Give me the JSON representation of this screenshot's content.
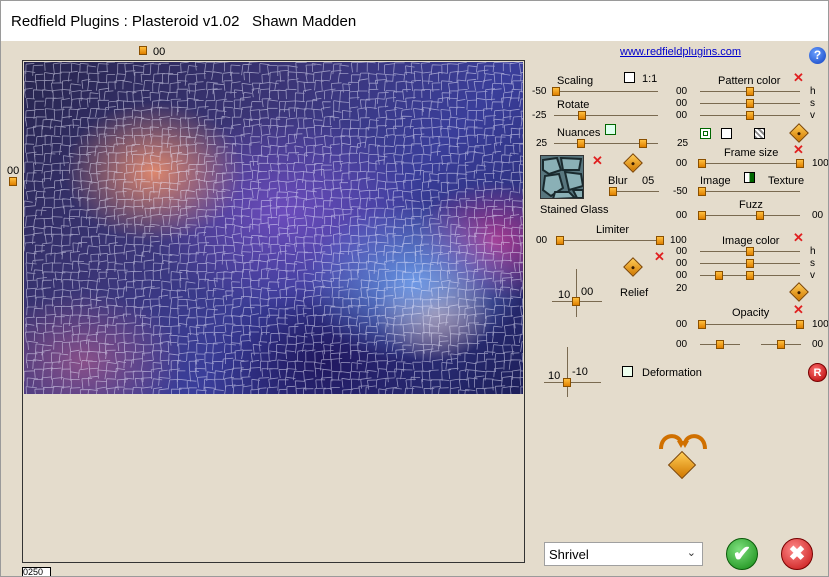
{
  "title": "Redfield Plugins : Plasteroid v1.02   Shawn Madden",
  "link_text": "www.redfieldplugins.com",
  "help_label": "?",
  "preview": {
    "top_value": "00",
    "left_value": "00",
    "coord_value": "0250"
  },
  "scaling": {
    "label": "Scaling",
    "ratio_label": "1:1",
    "value": "-50"
  },
  "rotate": {
    "label": "Rotate",
    "value": "-25"
  },
  "nuances": {
    "label": "Nuances",
    "left_value": "25",
    "right_value": "25"
  },
  "stained_glass": {
    "label": "Stained Glass"
  },
  "blur": {
    "label": "Blur",
    "value": "05"
  },
  "limiter": {
    "label": "Limiter",
    "min": "00",
    "max": "100"
  },
  "relief": {
    "label": "Relief",
    "x": "10",
    "y": "00"
  },
  "deformation": {
    "label": "Deformation",
    "x": "10",
    "y": "-10"
  },
  "pattern_color": {
    "label": "Pattern color",
    "h": "00",
    "s": "00",
    "v": "00",
    "h_label": "h",
    "s_label": "s",
    "v_label": "v"
  },
  "frame_size": {
    "label": "Frame size",
    "min": "00",
    "max": "100"
  },
  "image_texture": {
    "image_label": "Image",
    "texture_label": "Texture",
    "value": "-50"
  },
  "fuzz": {
    "label": "Fuzz",
    "left": "00",
    "right": "00"
  },
  "image_color": {
    "label": "Image color",
    "h": "00",
    "s": "00",
    "v": "00",
    "extra": "20",
    "h_label": "h",
    "s_label": "s",
    "v_label": "v"
  },
  "opacity": {
    "label": "Opacity",
    "min": "00",
    "max": "100",
    "bottom_left": "00",
    "bottom_right": "00"
  },
  "reset_label": "R",
  "preset": {
    "selected": "Shrivel",
    "arrow": "⌄"
  },
  "ok_label": "✔",
  "cancel_label": "✖",
  "colors": {
    "accent": "#e08000",
    "background": "#e4dccc",
    "link": "#0000cc"
  }
}
